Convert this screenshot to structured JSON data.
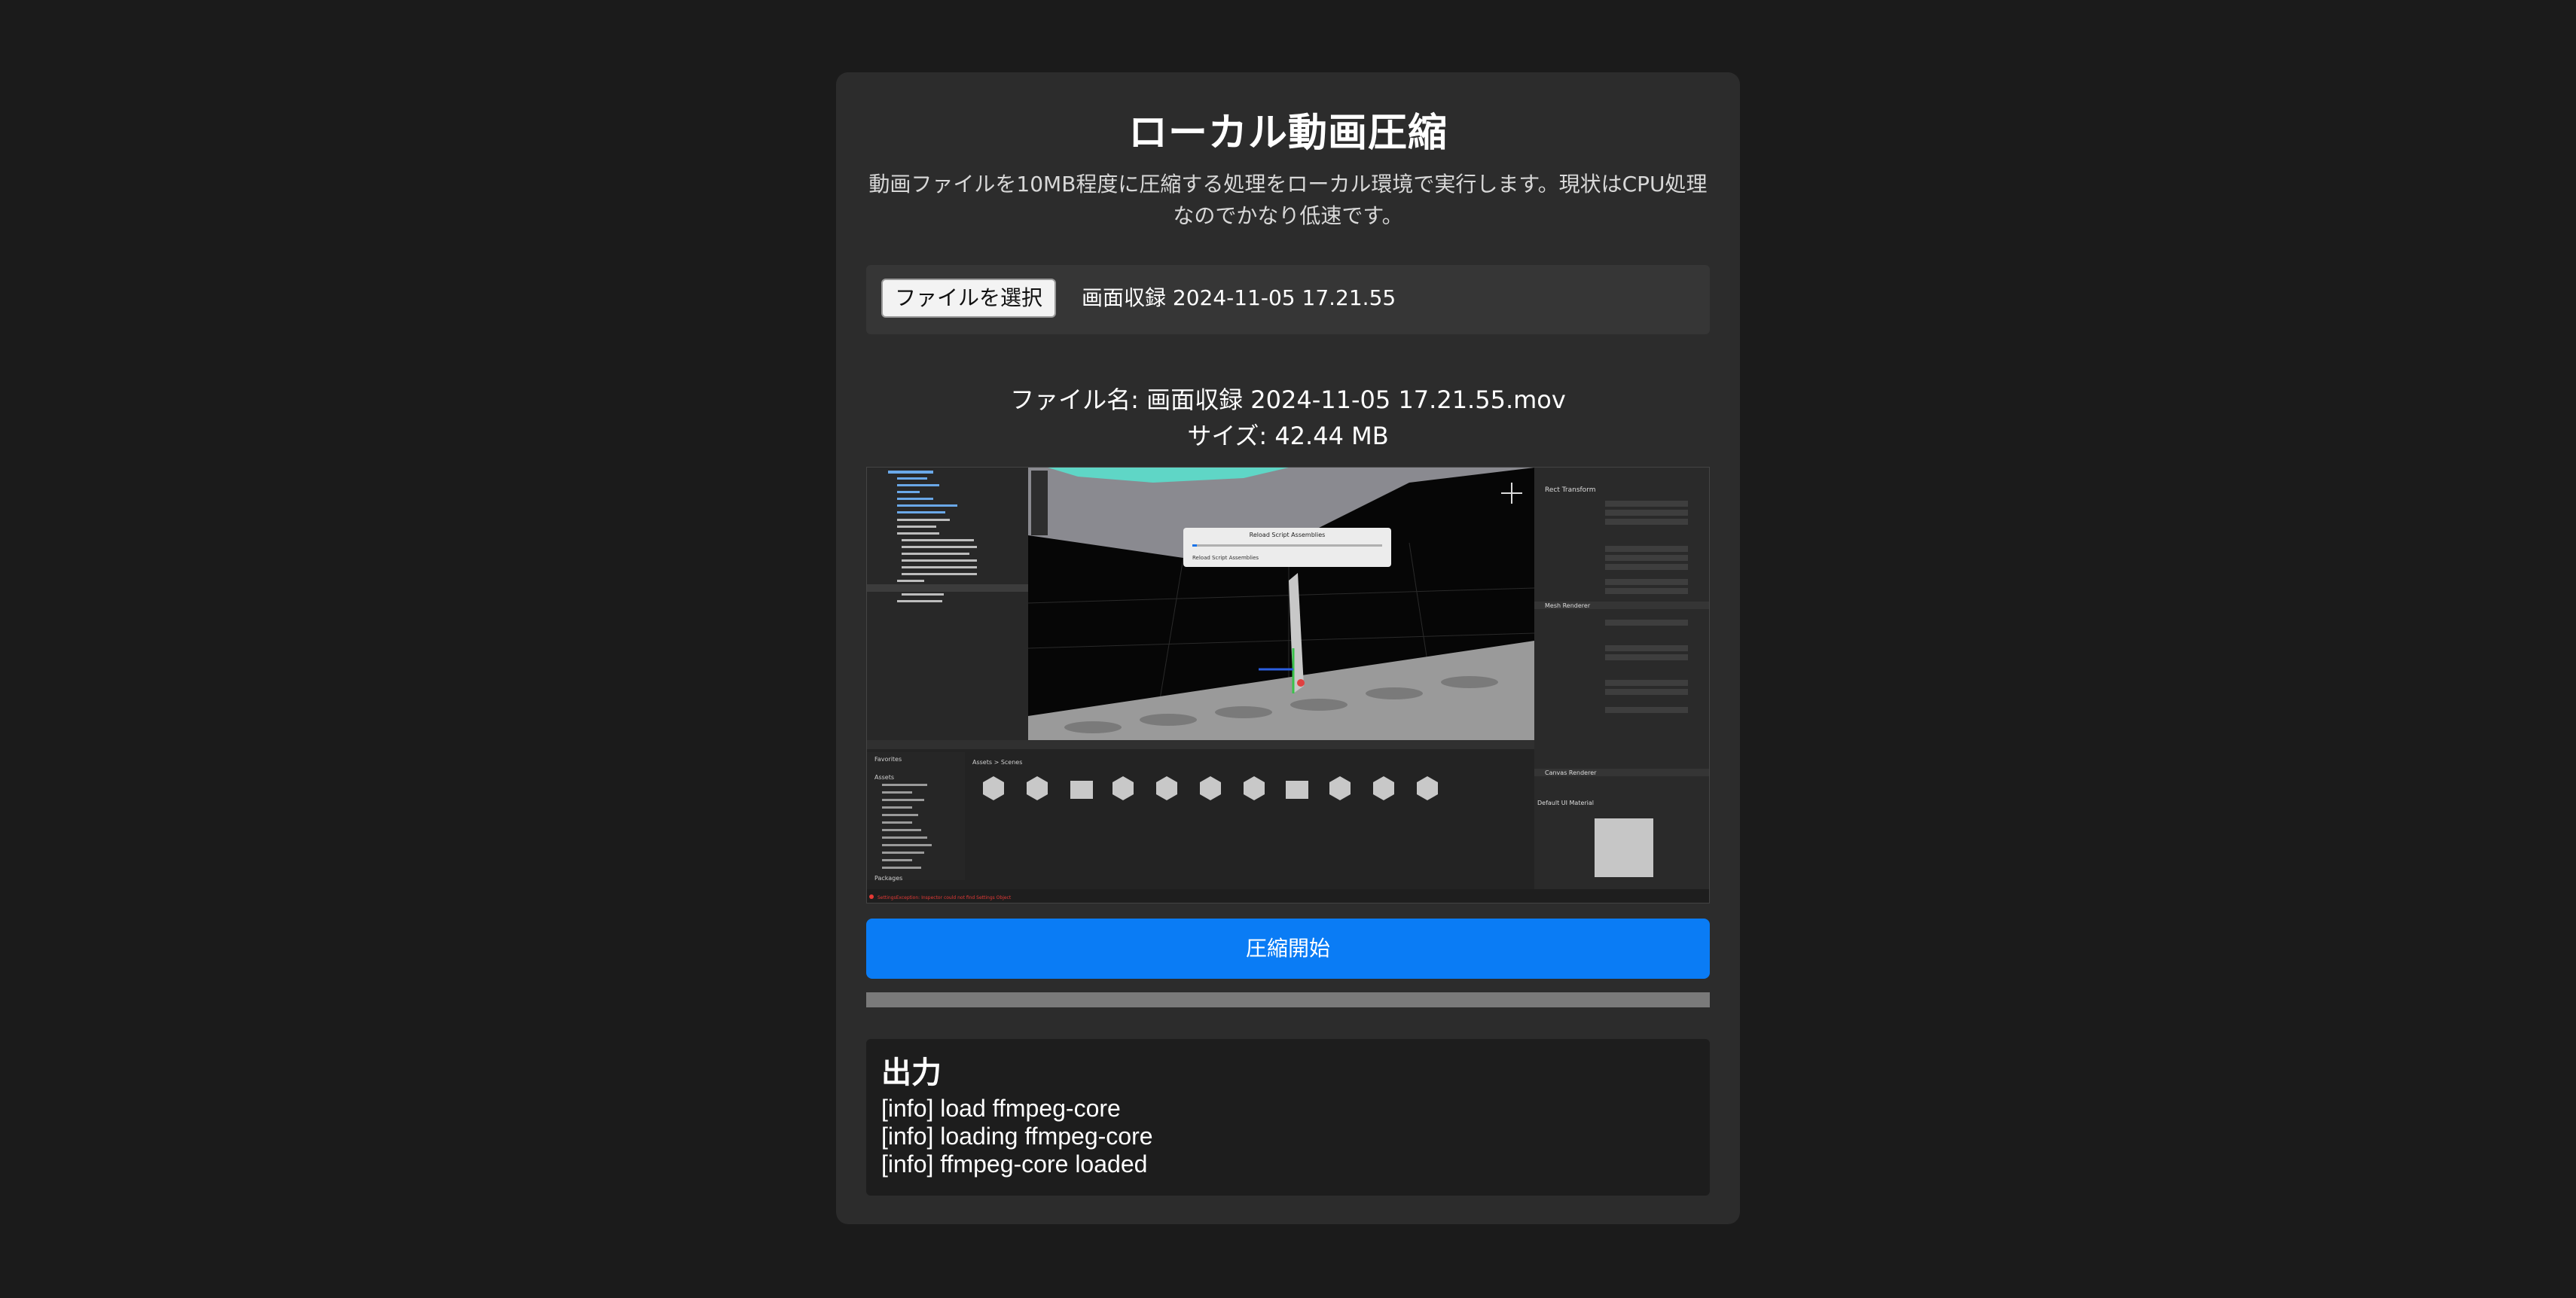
{
  "page": {
    "title": "ローカル動画圧縮",
    "description": "動画ファイルを10MB程度に圧縮する処理をローカル環境で実行します。現状はCPU処理なのでかなり低速です。"
  },
  "file_input": {
    "button_label": "ファイルを選択",
    "selected_file": "画面収録 2024-11-05 17.21.55"
  },
  "file_info": {
    "name_line": "ファイル名: 画面収録 2024-11-05 17.21.55.mov",
    "size_line": "サイズ: 42.44 MB"
  },
  "preview": {
    "dialog_title": "Reload Script Assemblies",
    "dialog_text": "Reload Script Assemblies",
    "inspector_header": "Rect Transform",
    "renderer_header": "Mesh Renderer",
    "canvas_header": "Canvas Renderer",
    "material_label": "Default UI Material",
    "breadcrumb": "Assets > Scenes",
    "folder_labels": [
      "Favorites",
      "Assets",
      "Packages"
    ],
    "error_line": "SettingsException: Inspector could not find Settings Object"
  },
  "actions": {
    "compress_label": "圧縮開始"
  },
  "progress": {
    "value": 0
  },
  "output": {
    "title": "出力",
    "lines": [
      "[info] load ffmpeg-core",
      "[info] loading ffmpeg-core",
      "[info] ffmpeg-core loaded"
    ]
  },
  "colors": {
    "background": "#1b1b1b",
    "card": "#2c2c2c",
    "accent": "#0a7cf5"
  }
}
